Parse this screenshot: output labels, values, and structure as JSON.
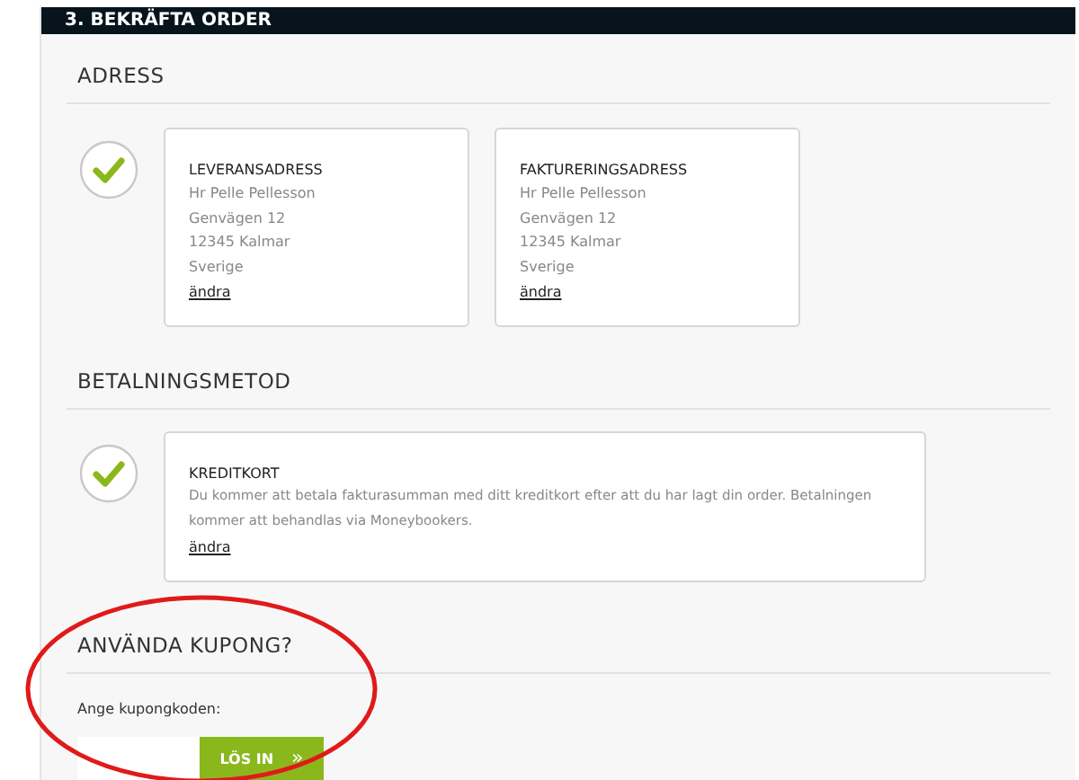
{
  "header": {
    "title": "3. BEKRÄFTA ORDER"
  },
  "address": {
    "heading": "ADRESS",
    "confirmed": true,
    "cards": [
      {
        "title": "LEVERANSADRESS",
        "lines": [
          "Hr Pelle Pellesson",
          "Genvägen 12",
          "12345 Kalmar",
          "Sverige"
        ],
        "link": "ändra"
      },
      {
        "title": "FAKTURERINGSADRESS",
        "lines": [
          "Hr Pelle Pellesson",
          "Genvägen 12",
          "12345 Kalmar",
          "Sverige"
        ],
        "link": "ändra"
      }
    ]
  },
  "payment": {
    "heading": "BETALNINGSMETOD",
    "confirmed": true,
    "card": {
      "title": "KREDITKORT",
      "description": "Du kommer att betala fakturasumman med ditt kreditkort efter att du har lagt din order. Betalningen kommer att behandlas via Moneybookers.",
      "link": "ändra"
    }
  },
  "coupon": {
    "heading": "ANVÄNDA KUPONG?",
    "label": "Ange kupongkoden:",
    "button": "LÖS IN",
    "button_icon": "»"
  }
}
